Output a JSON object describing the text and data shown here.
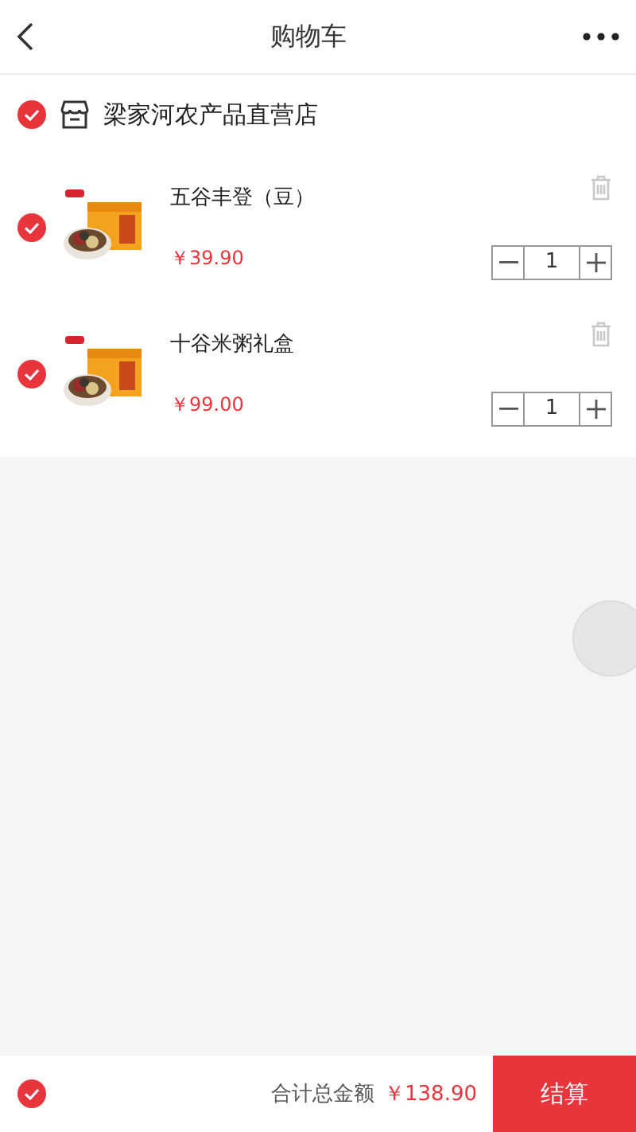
{
  "header": {
    "title": "购物车"
  },
  "store": {
    "name": "梁家河农产品直营店",
    "checked": true
  },
  "items": [
    {
      "name": "五谷丰登（豆）",
      "price": "￥39.90",
      "quantity": "1",
      "checked": true
    },
    {
      "name": "十谷米粥礼盒",
      "price": "￥99.00",
      "quantity": "1",
      "checked": true
    }
  ],
  "footer": {
    "all_checked": true,
    "total_label": "合计总金额",
    "total": "￥138.90",
    "checkout": "结算"
  }
}
